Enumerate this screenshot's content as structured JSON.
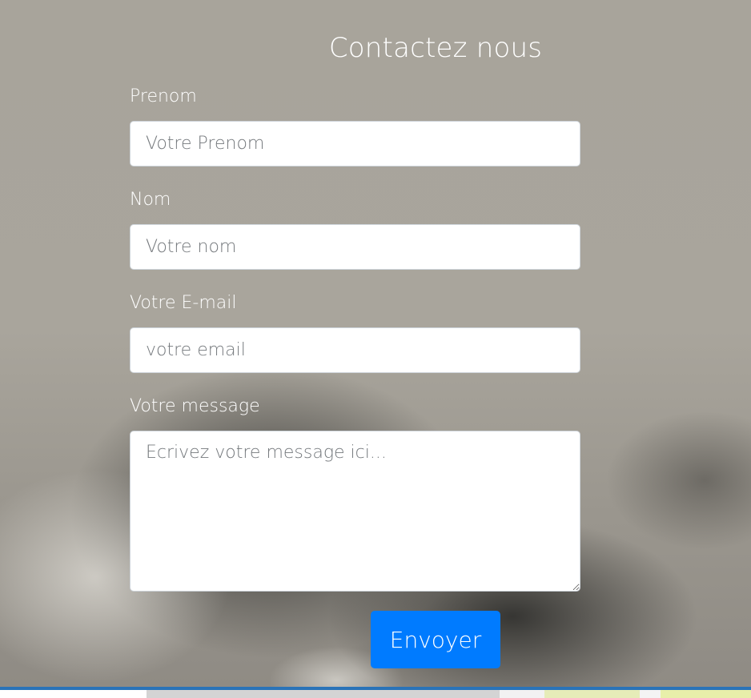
{
  "page": {
    "title": "Contactez nous"
  },
  "form": {
    "fields": [
      {
        "label": "Prenom",
        "placeholder": "Votre Prenom",
        "value": ""
      },
      {
        "label": "Nom",
        "placeholder": "Votre nom",
        "value": ""
      },
      {
        "label": "Votre E-mail",
        "placeholder": "votre email",
        "value": ""
      },
      {
        "label": "Votre message",
        "placeholder": "Ecrivez votre message ici...",
        "value": ""
      }
    ],
    "submit_label": "Envoyer"
  },
  "colors": {
    "accent": "#007bff",
    "footer_line": "#2a73b8",
    "text_on_bg": "#ffffff"
  }
}
